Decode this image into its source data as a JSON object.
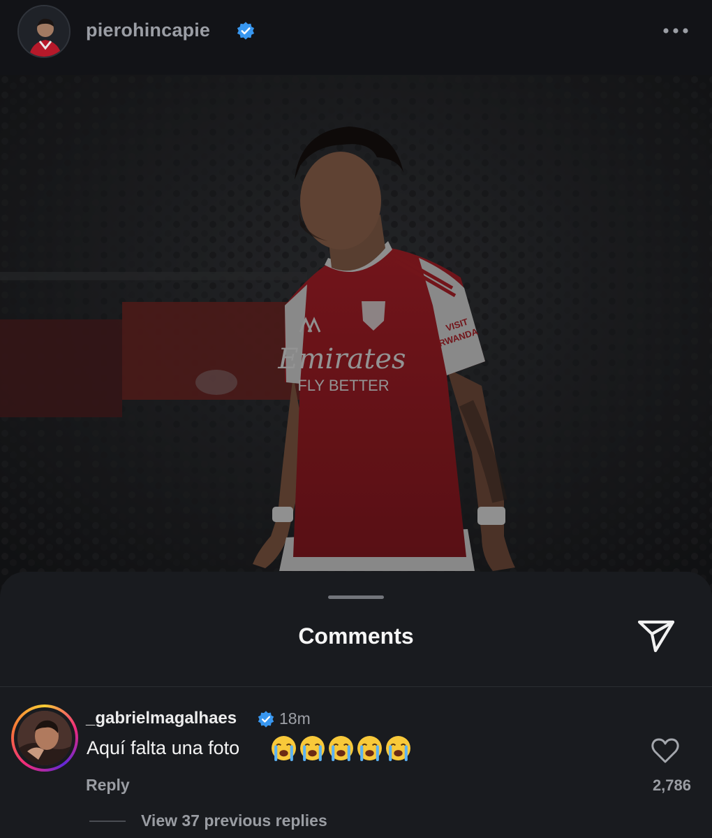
{
  "header": {
    "username": "pierohincapie",
    "verified": true
  },
  "post": {
    "image_subject": "football player in red and white kit",
    "shirt_sponsor_line1": "Emirates",
    "shirt_sponsor_line2": "FLY BETTER",
    "sleeve_text_line1": "VISIT",
    "sleeve_text_line2": "RWANDA"
  },
  "comments_sheet": {
    "title": "Comments",
    "comment": {
      "username": "_gabrielmagalhaes",
      "verified": true,
      "time": "18m",
      "text": "Aquí falta una foto",
      "emoji_count": 5,
      "reply_label": "Reply",
      "like_count": "2,786",
      "view_replies_label": "View 37 previous replies"
    }
  },
  "colors": {
    "background": "#0e1013",
    "sheet": "#191b1f",
    "verified_blue": "#3897f0",
    "arsenal_red": "#c8102e"
  }
}
